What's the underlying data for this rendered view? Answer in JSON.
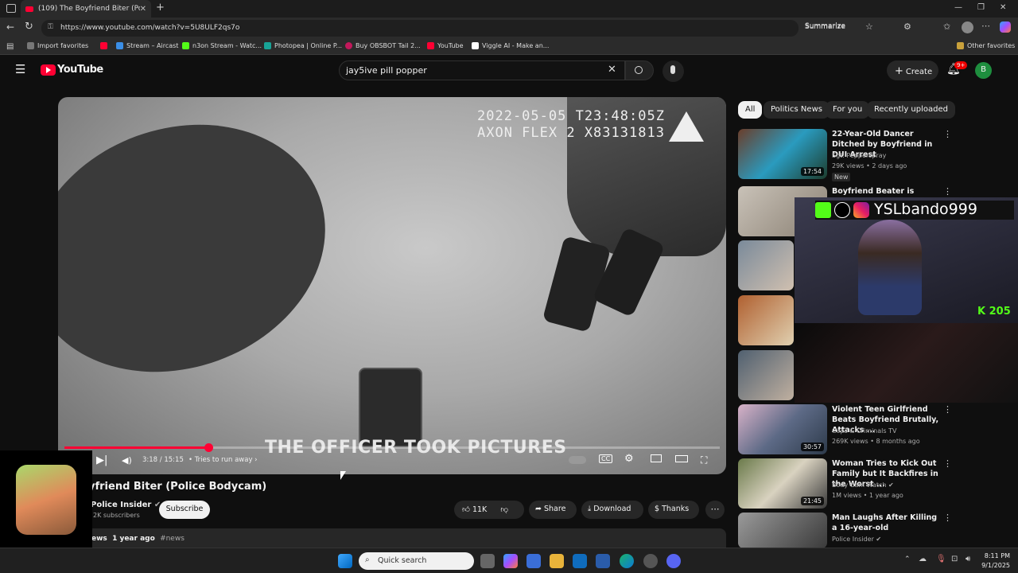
{
  "browser": {
    "tab_title": "(109) The Boyfriend Biter (Police I",
    "url": "https://www.youtube.com/watch?v=5U8ULF2qs7o",
    "summarize_label": "Summarize",
    "bookmarks": [
      "Import favorites",
      "Stream – Aircast",
      "n3on Stream - Watc...",
      "Photopea | Online P...",
      "Buy OBSBOT Tail 2...",
      "YouTube",
      "Viggle AI - Make an..."
    ],
    "other_favorites": "Other favorites"
  },
  "youtube": {
    "logo_text": "YouTube",
    "search_value": "jay5ive pill popper",
    "create_label": "Create",
    "notif_count": "9+",
    "avatar_letter": "B"
  },
  "video": {
    "timestamp_line1": "2022-05-05 T23:48:05Z",
    "timestamp_line2": "AXON FLEX 2 X83131813",
    "caption": "THE OFFICER TOOK PICTURES",
    "time": "3:18 / 15:15",
    "chapter": "Tries to run away",
    "progress_fraction": 0.22,
    "title": "yfriend Biter (Police Bodycam)",
    "channel": "Police Insider",
    "subscribers": "2K subscribers",
    "subscribe_label": "Subscribe",
    "likes": "11K",
    "share_label": "Share",
    "download_label": "Download",
    "thanks_label": "Thanks",
    "desc_prefix": "ews",
    "desc_age": "1 year ago",
    "desc_tag": "#news"
  },
  "chips": [
    "All",
    "Politics News",
    "For you",
    "Recently uploaded"
  ],
  "related": [
    {
      "title": "22-Year-Old Dancer Ditched by Boyfriend in DUI Arrest",
      "channel": "Sgt. Pepperspray",
      "meta": "29K views • 2 days ago",
      "badge": "New",
      "duration": "17:54"
    },
    {
      "title": "Boyfriend Beater is Convinced",
      "channel": "",
      "meta": "",
      "badge": "",
      "duration": ""
    },
    {
      "title": "Violent Teen Girlfriend Beats Boyfriend Brutally, Attacks ...",
      "channel": "Cops & Criminals TV",
      "meta": "269K views • 8 months ago",
      "badge": "",
      "duration": "30:57"
    },
    {
      "title": "Woman Tries to Kick Out Family but It Backfires in the Worst ...",
      "channel": "Body Cam Watch",
      "meta": "1M views • 1 year ago",
      "badge": "",
      "duration": "21:45"
    },
    {
      "title": "Man Laughs After Killing a 16-year-old",
      "channel": "Police Insider",
      "meta": "",
      "badge": "",
      "duration": ""
    }
  ],
  "overlay": {
    "handle": "YSLbando999",
    "kick_count": "205"
  },
  "taskbar": {
    "search_placeholder": "Quick search",
    "time": "8:11 PM",
    "date": "9/1/2025"
  }
}
